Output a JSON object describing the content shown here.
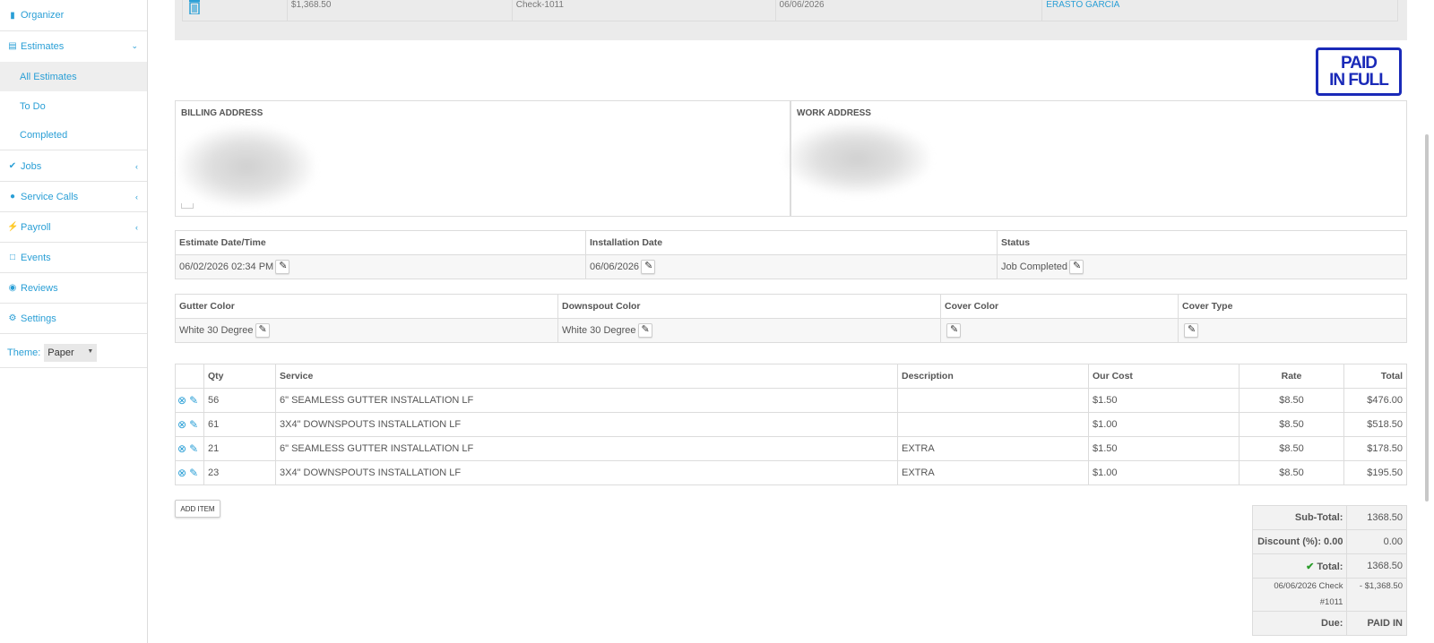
{
  "sidebar": {
    "organizer": "Organizer",
    "estimates": "Estimates",
    "all_estimates": "All Estimates",
    "to_do": "To Do",
    "completed": "Completed",
    "jobs": "Jobs",
    "service_calls": "Service Calls",
    "payroll": "Payroll",
    "events": "Events",
    "reviews": "Reviews",
    "settings": "Settings",
    "theme_label": "Theme:",
    "theme_value": "Paper"
  },
  "payment_row": {
    "amount": "$1,368.50",
    "reference": "Check-1011",
    "date": "06/06/2026",
    "user": "ERASTO GARCIA"
  },
  "stamp": {
    "line1": "PAID",
    "line2": "IN FULL"
  },
  "addresses": {
    "billing_title": "BILLING ADDRESS",
    "work_title": "WORK ADDRESS"
  },
  "dates": {
    "headers": [
      "Estimate Date/Time",
      "Installation Date",
      "Status"
    ],
    "values": [
      "06/02/2026 02:34 PM",
      "06/06/2026",
      "Job Completed"
    ]
  },
  "colors": {
    "headers": [
      "Gutter Color",
      "Downspout Color",
      "Cover Color",
      "Cover Type"
    ],
    "values": [
      "White 30 Degree",
      "White 30 Degree",
      "",
      ""
    ]
  },
  "items": {
    "headers": [
      "",
      "Qty",
      "Service",
      "Description",
      "Our Cost",
      "Rate",
      "Total"
    ],
    "rows": [
      {
        "qty": "56",
        "service": "6\" SEAMLESS GUTTER INSTALLATION LF",
        "description": "",
        "cost": "$1.50",
        "rate": "$8.50",
        "total": "$476.00"
      },
      {
        "qty": "61",
        "service": "3X4\" DOWNSPOUTS INSTALLATION LF",
        "description": "",
        "cost": "$1.00",
        "rate": "$8.50",
        "total": "$518.50"
      },
      {
        "qty": "21",
        "service": "6\" SEAMLESS GUTTER INSTALLATION LF",
        "description": "EXTRA",
        "cost": "$1.50",
        "rate": "$8.50",
        "total": "$178.50"
      },
      {
        "qty": "23",
        "service": "3X4\" DOWNSPOUTS INSTALLATION LF",
        "description": "EXTRA",
        "cost": "$1.00",
        "rate": "$8.50",
        "total": "$195.50"
      }
    ],
    "add_item": "ADD ITEM"
  },
  "totals": {
    "subtotal_label": "Sub-Total:",
    "subtotal": "1368.50",
    "discount_label": "Discount (%): 0.00",
    "discount": "0.00",
    "total_label": "Total:",
    "total": "1368.50",
    "payment_label": "06/06/2026 Check #1011",
    "payment": "- $1,368.50",
    "due_label": "Due:",
    "due": "PAID IN"
  }
}
